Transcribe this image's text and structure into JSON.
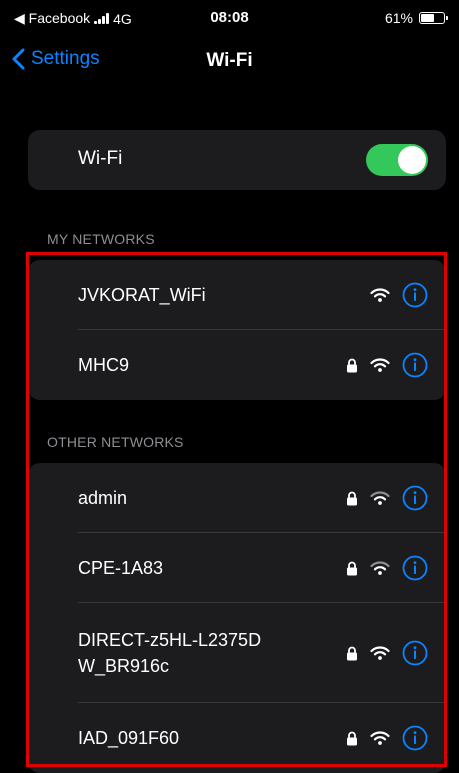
{
  "status_bar": {
    "back_app": "◀ Facebook",
    "network": "4G",
    "time": "08:08",
    "battery_percent": "61%",
    "battery_level": 0.61
  },
  "nav": {
    "back_label": "Settings",
    "title": "Wi-Fi"
  },
  "wifi_toggle": {
    "label": "Wi-Fi",
    "enabled": true
  },
  "my_networks": {
    "header": "MY NETWORKS",
    "items": [
      {
        "name": "JVKORAT_WiFi",
        "locked": false
      },
      {
        "name": "MHC9",
        "locked": true
      }
    ]
  },
  "other_networks": {
    "header": "OTHER NETWORKS",
    "items": [
      {
        "name": "admin",
        "locked": true
      },
      {
        "name": "CPE-1A83",
        "locked": true
      },
      {
        "name": "DIRECT-z5HL-L2375DW_BR916c",
        "locked": true
      },
      {
        "name": "IAD_091F60",
        "locked": true
      }
    ]
  },
  "colors": {
    "accent": "#0a84ff",
    "toggle_on": "#34c759",
    "highlight": "#e00000",
    "card": "#1c1c1e"
  }
}
